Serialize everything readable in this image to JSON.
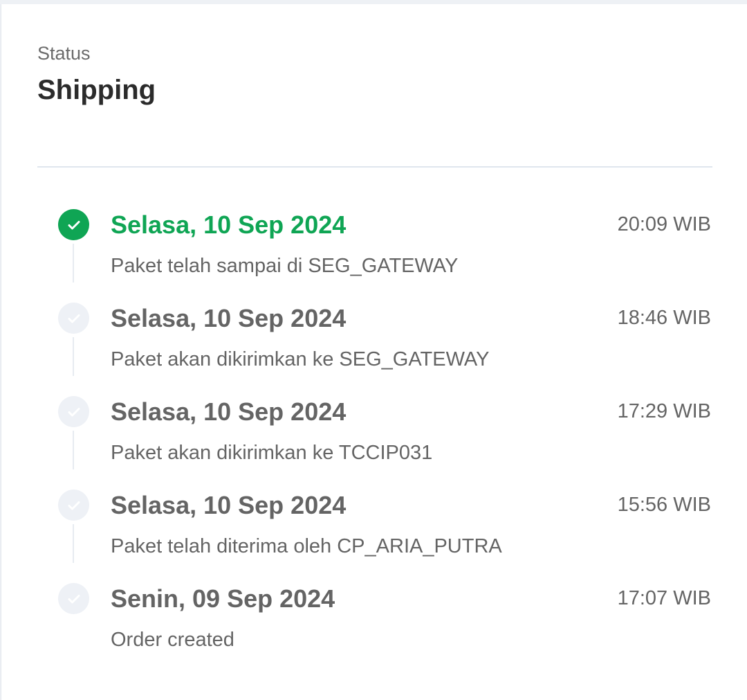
{
  "status": {
    "label": "Status",
    "value": "Shipping"
  },
  "colors": {
    "accent_green": "#0fa554",
    "inactive_dot": "#eef1f6",
    "text_muted": "#646464",
    "divider": "#dfe6ee"
  },
  "events": [
    {
      "date": "Selasa, 10 Sep 2024",
      "time": "20:09 WIB",
      "description": "Paket telah sampai di SEG_GATEWAY",
      "active": true,
      "icon": "check-icon"
    },
    {
      "date": "Selasa, 10 Sep 2024",
      "time": "18:46 WIB",
      "description": "Paket akan dikirimkan ke SEG_GATEWAY",
      "active": false,
      "icon": "check-icon"
    },
    {
      "date": "Selasa, 10 Sep 2024",
      "time": "17:29 WIB",
      "description": "Paket akan dikirimkan ke TCCIP031",
      "active": false,
      "icon": "check-icon"
    },
    {
      "date": "Selasa, 10 Sep 2024",
      "time": "15:56 WIB",
      "description": "Paket telah diterima oleh CP_ARIA_PUTRA",
      "active": false,
      "icon": "check-icon"
    },
    {
      "date": "Senin, 09 Sep 2024",
      "time": "17:07 WIB",
      "description": "Order created",
      "active": false,
      "icon": "check-icon"
    }
  ]
}
